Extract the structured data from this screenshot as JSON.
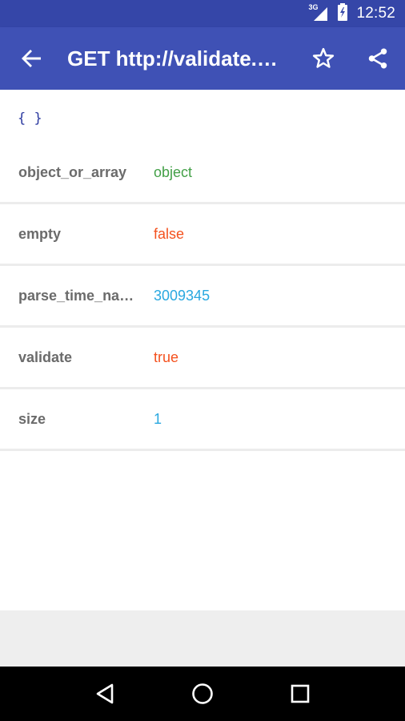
{
  "status_bar": {
    "network": "3G",
    "time": "12:52"
  },
  "app_bar": {
    "title": "GET http://validate.j…",
    "icons": [
      "back-arrow-icon",
      "star-outline-icon",
      "share-icon"
    ]
  },
  "content": {
    "root_symbol": "{ }",
    "rows": [
      {
        "key": "object_or_array",
        "value": "object",
        "value_color": "#43a047"
      },
      {
        "key": "empty",
        "value": "false",
        "value_color": "#f4511e"
      },
      {
        "key": "parse_time_na…",
        "value": "3009345",
        "value_color": "#29a8e0"
      },
      {
        "key": "validate",
        "value": "true",
        "value_color": "#f4511e"
      },
      {
        "key": "size",
        "value": "1",
        "value_color": "#29a8e0"
      }
    ]
  },
  "nav_bar": {
    "icons": [
      "back-triangle-icon",
      "home-circle-icon",
      "recents-square-icon"
    ]
  },
  "colors": {
    "primary": "#3f51b5",
    "primary_dark": "#3546a8"
  }
}
